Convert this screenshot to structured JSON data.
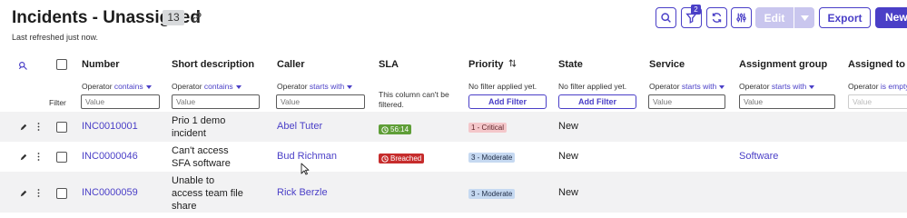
{
  "header": {
    "title": "Incidents - Unassigned",
    "count": "13",
    "refreshed": "Last refreshed just now.",
    "filter_badge": "2",
    "edit_label": "Edit",
    "export_label": "Export",
    "new_label": "New"
  },
  "columns": {
    "number": "Number",
    "short_description": "Short description",
    "caller": "Caller",
    "sla": "SLA",
    "priority": "Priority",
    "state": "State",
    "service": "Service",
    "assignment_group": "Assignment group",
    "assigned_to": "Assigned to"
  },
  "filters": {
    "row_label": "Filter",
    "operator_prefix": "Operator",
    "number_op": "contains",
    "short_description_op": "contains",
    "caller_op": "starts with",
    "service_op": "starts with",
    "assignment_group_op": "starts with",
    "assigned_to_op": "is empty",
    "value_placeholder": "Value",
    "sla_note": "This column can't be filtered.",
    "no_filter": "No filter applied yet.",
    "add_filter": "Add Filter"
  },
  "rows": [
    {
      "number": "INC0010001",
      "description_line1": "Prio 1 demo",
      "description_line2": "incident",
      "description_line3": "",
      "caller": "Abel Tuter",
      "sla": "56:14",
      "priority": "1 - Critical",
      "state": "New",
      "assignment_group": ""
    },
    {
      "number": "INC0000046",
      "description_line1": "Can't access",
      "description_line2": "SFA software",
      "description_line3": "",
      "caller": "Bud Richman",
      "sla": "Breached",
      "priority": "3 - Moderate",
      "state": "New",
      "assignment_group": "Software"
    },
    {
      "number": "INC0000059",
      "description_line1": "Unable to",
      "description_line2": "access team file",
      "description_line3": "share",
      "caller": "Rick Berzle",
      "sla": "",
      "priority": "3 - Moderate",
      "state": "New",
      "assignment_group": ""
    }
  ],
  "colors": {
    "accent": "#4a3fc7",
    "sla_ok": "#5f9e37",
    "sla_breached": "#c62c2c",
    "priority_critical_bg": "#f4c7ca",
    "priority_moderate_bg": "#c6d9f1",
    "row_alt": "#f2f2f3"
  },
  "icons": [
    "link-icon",
    "search-icon",
    "filter-icon",
    "refresh-icon",
    "settings-sliders-icon",
    "chevron-down-icon",
    "sort-icon",
    "pencil-icon",
    "kebab-icon",
    "clock-icon",
    "alert-clock-icon",
    "personalize-icon",
    "mouse-cursor-icon"
  ]
}
